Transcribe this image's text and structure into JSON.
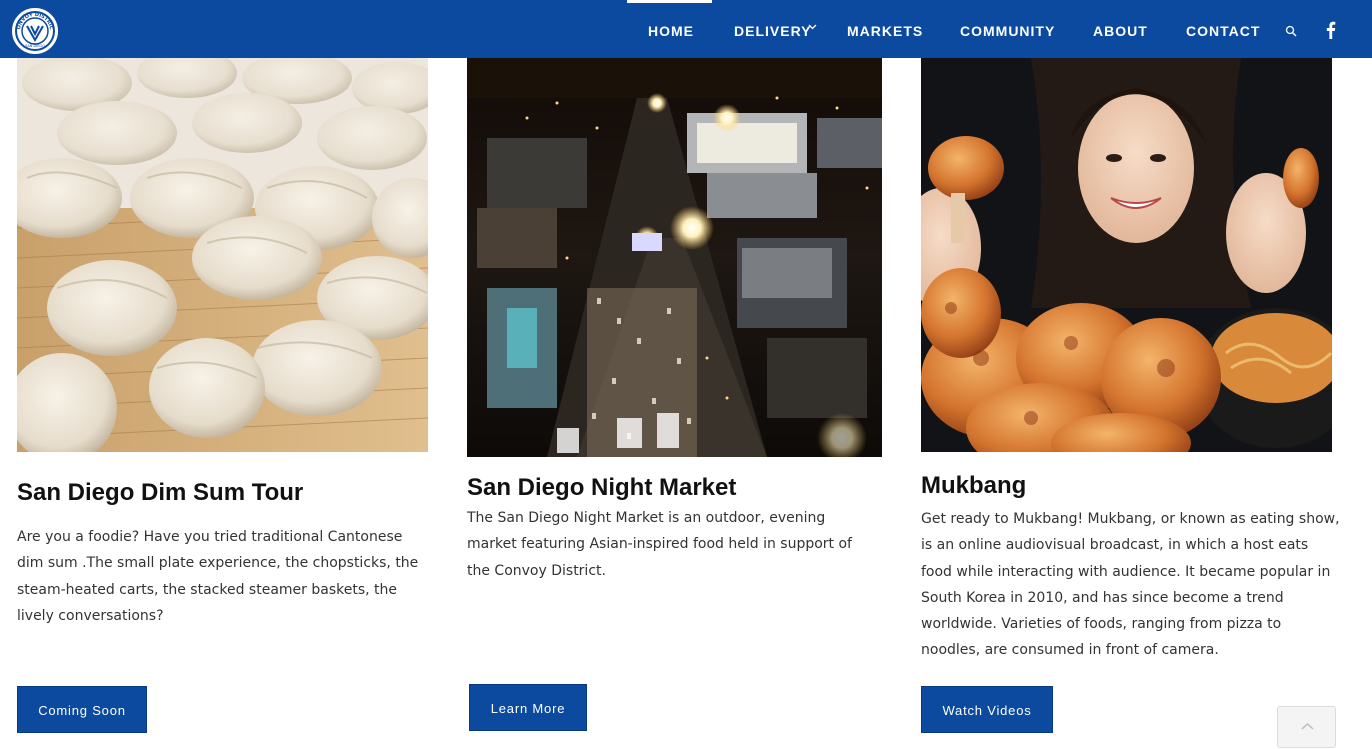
{
  "nav": {
    "logo_text": "CONVOY DISTRICT",
    "logo_subtext": "SAN DIEGO",
    "items": [
      {
        "label": "HOME"
      },
      {
        "label": "DELIVERY"
      },
      {
        "label": "MARKETS"
      },
      {
        "label": "COMMUNITY"
      },
      {
        "label": "ABOUT"
      },
      {
        "label": "CONTACT"
      }
    ],
    "active_item": "HOME",
    "icons": [
      "search-icon",
      "facebook-icon",
      "chevron-down-icon"
    ]
  },
  "cards": [
    {
      "title": "San Diego Dim Sum Tour",
      "text": "Are you a foodie? Have you tried traditional Cantonese dim sum .The small plate experience, the chopsticks, the steam-heated carts, the stacked steamer baskets, the lively conversations?",
      "button": "Coming Soon"
    },
    {
      "title": "San Diego Night Market",
      "text": "The San Diego Night Market is an outdoor, evening market featuring Asian-inspired food held in support of the Convoy District.",
      "button": "Learn More"
    },
    {
      "title": "Mukbang",
      "text": "Get ready to Mukbang! Mukbang, or known as eating show, is an online audiovisual broadcast, in which a host eats food while interacting with audience. It became popular in South Korea in 2010, and has since become a trend worldwide. Varieties of foods, ranging from pizza to noodles, are consumed in front of camera.",
      "button": "Watch Videos"
    }
  ],
  "colors": {
    "nav_background": "#0c4aa0",
    "button_background": "#0c4aa0",
    "title_text": "#111111",
    "body_text": "#333333"
  }
}
